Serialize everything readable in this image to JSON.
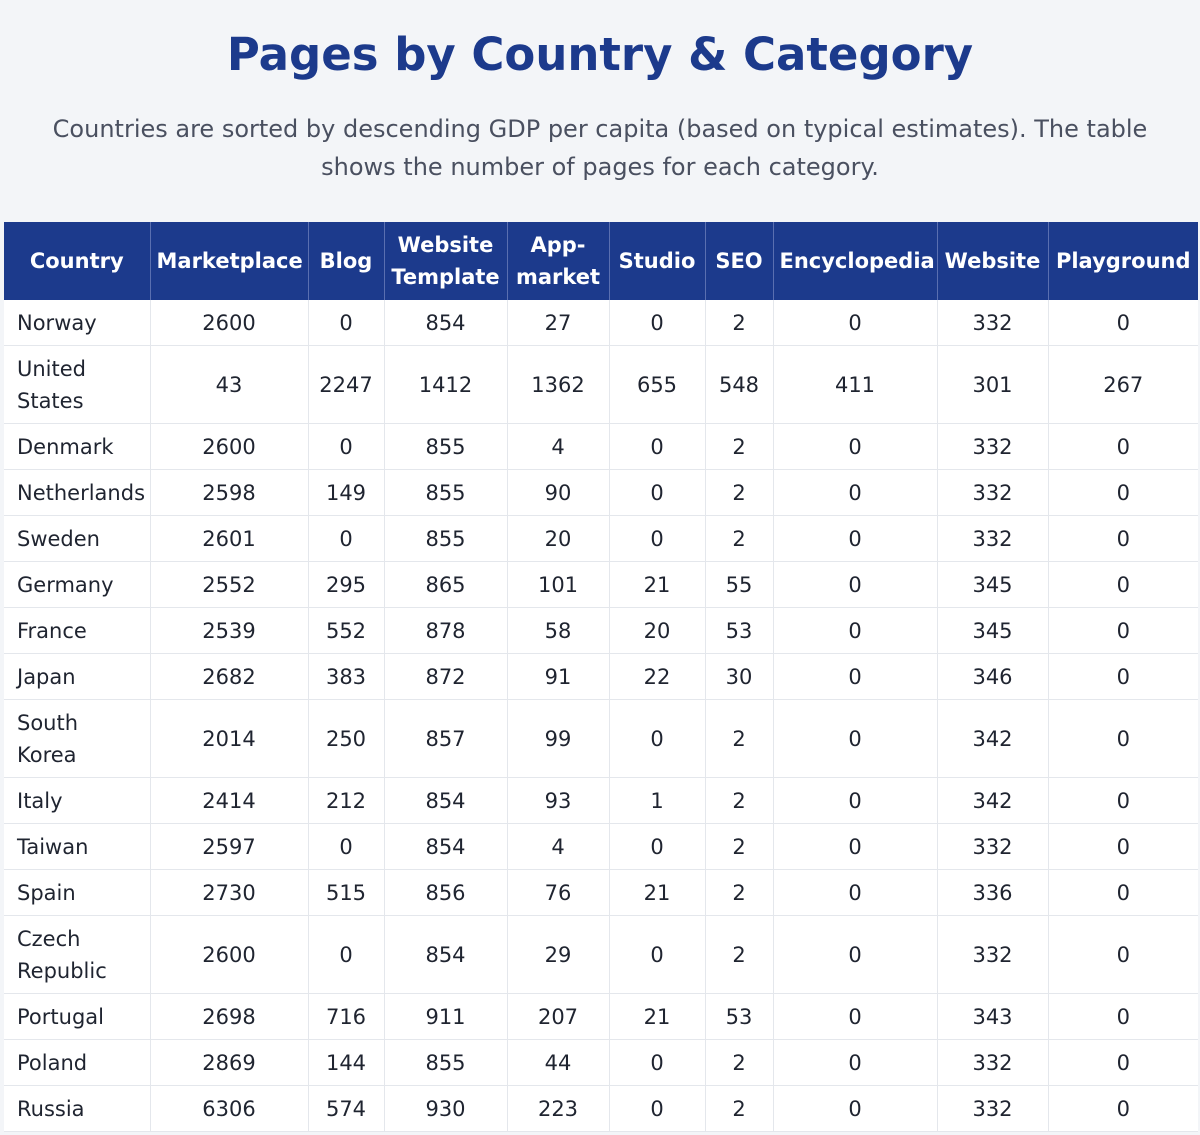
{
  "title": "Pages by Country & Category",
  "subtitle": "Countries are sorted by descending GDP per capita (based on typical estimates). The table shows the number of pages for each category.",
  "columns": [
    "Country",
    "Marketplace",
    "Blog",
    "Website Template",
    "App-market",
    "Studio",
    "SEO",
    "Encyclopedia",
    "Website",
    "Playground"
  ],
  "rows": [
    [
      "Norway",
      "2600",
      "0",
      "854",
      "27",
      "0",
      "2",
      "0",
      "332",
      "0"
    ],
    [
      "United States",
      "43",
      "2247",
      "1412",
      "1362",
      "655",
      "548",
      "411",
      "301",
      "267"
    ],
    [
      "Denmark",
      "2600",
      "0",
      "855",
      "4",
      "0",
      "2",
      "0",
      "332",
      "0"
    ],
    [
      "Netherlands",
      "2598",
      "149",
      "855",
      "90",
      "0",
      "2",
      "0",
      "332",
      "0"
    ],
    [
      "Sweden",
      "2601",
      "0",
      "855",
      "20",
      "0",
      "2",
      "0",
      "332",
      "0"
    ],
    [
      "Germany",
      "2552",
      "295",
      "865",
      "101",
      "21",
      "55",
      "0",
      "345",
      "0"
    ],
    [
      "France",
      "2539",
      "552",
      "878",
      "58",
      "20",
      "53",
      "0",
      "345",
      "0"
    ],
    [
      "Japan",
      "2682",
      "383",
      "872",
      "91",
      "22",
      "30",
      "0",
      "346",
      "0"
    ],
    [
      "South Korea",
      "2014",
      "250",
      "857",
      "99",
      "0",
      "2",
      "0",
      "342",
      "0"
    ],
    [
      "Italy",
      "2414",
      "212",
      "854",
      "93",
      "1",
      "2",
      "0",
      "342",
      "0"
    ],
    [
      "Taiwan",
      "2597",
      "0",
      "854",
      "4",
      "0",
      "2",
      "0",
      "332",
      "0"
    ],
    [
      "Spain",
      "2730",
      "515",
      "856",
      "76",
      "21",
      "2",
      "0",
      "336",
      "0"
    ],
    [
      "Czech Republic",
      "2600",
      "0",
      "854",
      "29",
      "0",
      "2",
      "0",
      "332",
      "0"
    ],
    [
      "Portugal",
      "2698",
      "716",
      "911",
      "207",
      "21",
      "53",
      "0",
      "343",
      "0"
    ],
    [
      "Poland",
      "2869",
      "144",
      "855",
      "44",
      "0",
      "2",
      "0",
      "332",
      "0"
    ],
    [
      "Russia",
      "6306",
      "574",
      "930",
      "223",
      "0",
      "2",
      "0",
      "332",
      "0"
    ]
  ]
}
